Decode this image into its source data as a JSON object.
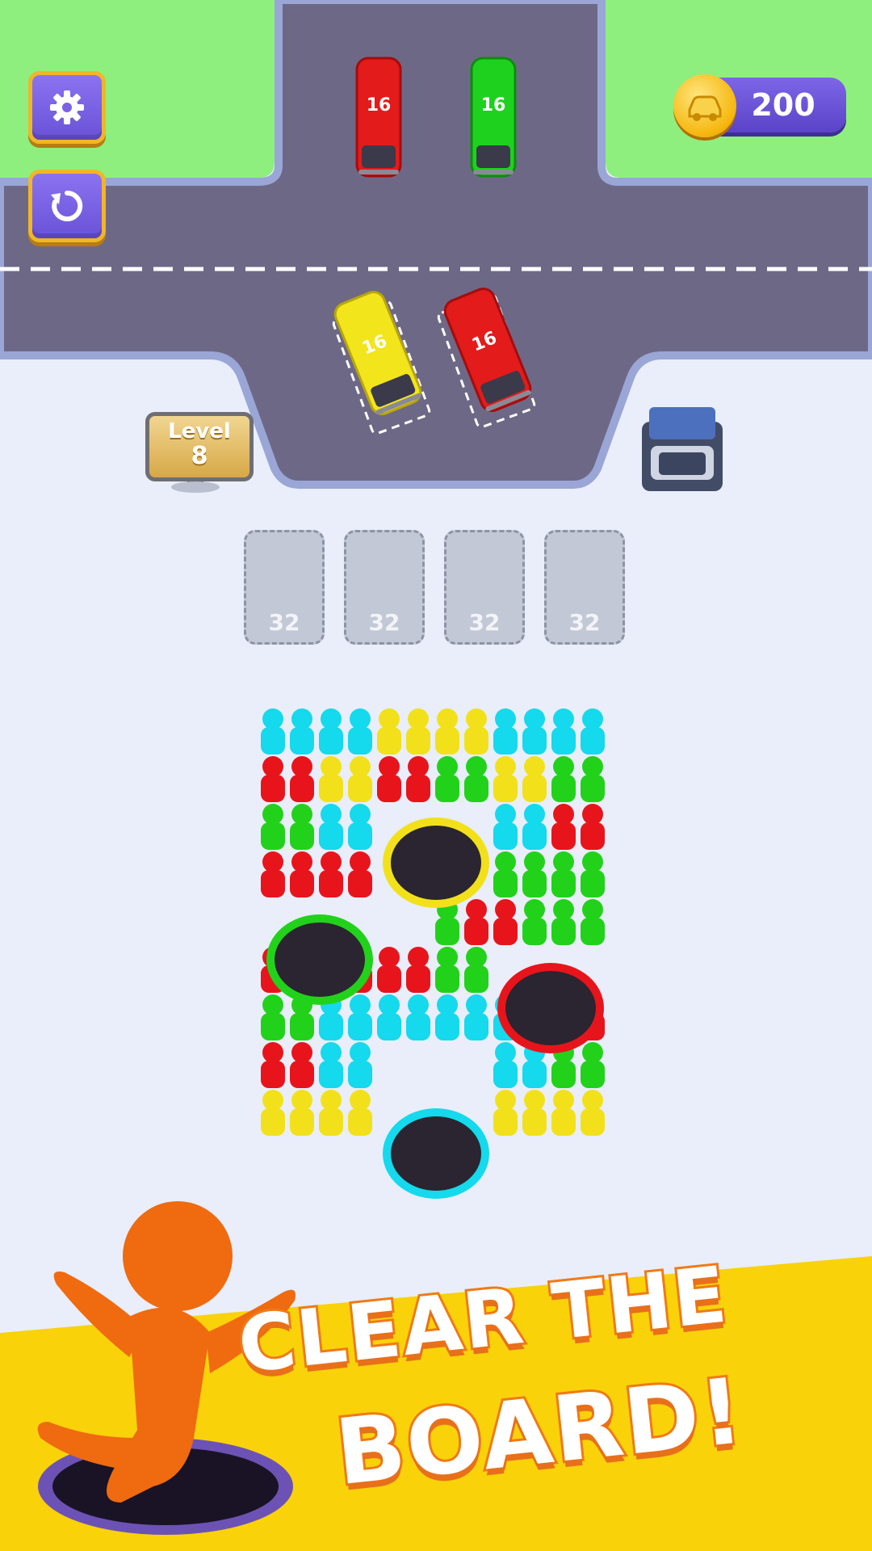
{
  "hud": {
    "coins": "200",
    "level_label": "Level",
    "level_number": "8"
  },
  "buses": [
    {
      "color": "#e31b1b",
      "capacity": "16",
      "state": "waiting"
    },
    {
      "color": "#1fd11f",
      "capacity": "16",
      "state": "waiting"
    },
    {
      "color": "#f2e51c",
      "capacity": "16",
      "state": "parked"
    },
    {
      "color": "#e31b1b",
      "capacity": "16",
      "state": "parked"
    }
  ],
  "slots": [
    "32",
    "32",
    "32",
    "32"
  ],
  "board": {
    "columns": 12,
    "rows": [
      "CCCCYYYYCCCC",
      "RRYYRRGGYYGG",
      "GGCC....CCRR",
      "RRRR....GGGG",
      "......GRRGGG",
      "RRRRRRGG....",
      "GGCCCCCCCCRR",
      "RRCC....CCGG",
      "YYYY....YYYY"
    ],
    "legend": {
      "C": "#15d9ec",
      "Y": "#f2e11a",
      "R": "#e8141c",
      "G": "#22d21a"
    },
    "holes": [
      {
        "color": "#f2e11a",
        "label": "yellow-hole"
      },
      {
        "color": "#22d21a",
        "label": "green-hole"
      },
      {
        "color": "#e8141c",
        "label": "red-hole"
      },
      {
        "color": "#15d9ec",
        "label": "cyan-hole"
      }
    ]
  },
  "banner": {
    "line1": "CLEAR THE",
    "line2": "BOARD!"
  },
  "icons": [
    "gear-icon",
    "restart-icon",
    "car-icon",
    "garage-icon"
  ]
}
